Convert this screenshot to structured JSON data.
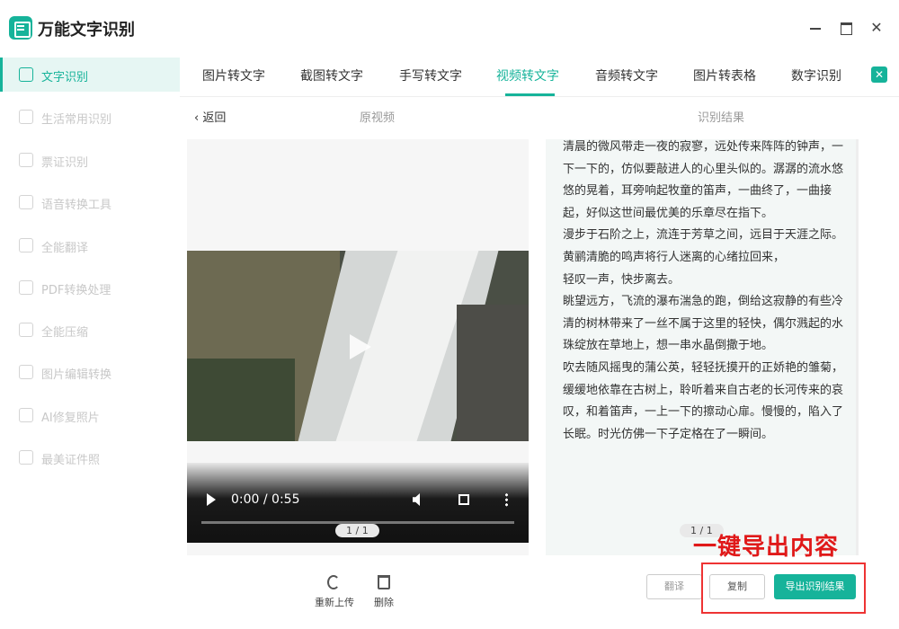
{
  "app": {
    "title": "万能文字识别"
  },
  "window": {
    "close_glyph": "✕"
  },
  "sidebar": {
    "items": [
      {
        "label": "文字识别",
        "icon": "text-scan-icon",
        "active": true
      },
      {
        "label": "生活常用识别",
        "icon": "life-scan-icon"
      },
      {
        "label": "票证识别",
        "icon": "ticket-scan-icon"
      },
      {
        "label": "语音转换工具",
        "icon": "voice-convert-icon"
      },
      {
        "label": "全能翻译",
        "icon": "translate-icon"
      },
      {
        "label": "PDF转换处理",
        "icon": "pdf-icon"
      },
      {
        "label": "全能压缩",
        "icon": "compress-icon"
      },
      {
        "label": "图片编辑转换",
        "icon": "image-edit-icon"
      },
      {
        "label": "AI修复照片",
        "icon": "ai-repair-icon"
      },
      {
        "label": "最美证件照",
        "icon": "id-photo-icon"
      }
    ]
  },
  "tabs": [
    {
      "label": "图片转文字"
    },
    {
      "label": "截图转文字"
    },
    {
      "label": "手写转文字"
    },
    {
      "label": "视频转文字",
      "active": true
    },
    {
      "label": "音频转文字"
    },
    {
      "label": "图片转表格"
    },
    {
      "label": "数字识别"
    }
  ],
  "tabs_more_glyph": "✕",
  "subheader": {
    "back_label": "‹  返回",
    "original_title": "原视频",
    "result_title": "识别结果"
  },
  "video": {
    "time": "0:00 / 0:55",
    "progress": 0,
    "page_indicator": "1 / 1"
  },
  "result": {
    "paragraphs": [
      "清晨的微风带走一夜的寂寥，远处传来阵阵的钟声，一下一下的，仿似要敲进人的心里头似的。潺潺的流水悠悠的晃着，耳旁响起牧童的笛声，一曲终了，一曲接起，好似这世间最优美的乐章尽在指下。",
      "漫步于石阶之上，流连于芳草之间，远目于天涯之际。",
      "黄鹂清脆的鸣声将行人迷离的心绪拉回来，",
      "轻叹一声，快步离去。",
      "眺望远方，飞流的瀑布湍急的跑，倒给这寂静的有些冷清的树林带来了一丝不属于这里的轻快，偶尔溅起的水珠绽放在草地上，想一串水晶倒撒于地。",
      "吹去随风摇曳的蒲公英，轻轻抚摸开的正娇艳的雏菊，缓缓地依靠在古树上，聆听着来自古老的长河传来的哀叹，和着笛声，一上一下的擦动心扉。慢慢的，陷入了长眠。时光仿佛一下子定格在了一瞬间。"
    ],
    "page_indicator": "1 / 1"
  },
  "actions": {
    "reupload_label": "重新上传",
    "delete_label": "删除",
    "translate_label": "翻译",
    "copy_label": "复制",
    "export_label": "导出识别结果"
  },
  "annotation": {
    "callout": "一键导出内容",
    "color": "#e01919"
  },
  "colors": {
    "accent": "#16b39a"
  }
}
